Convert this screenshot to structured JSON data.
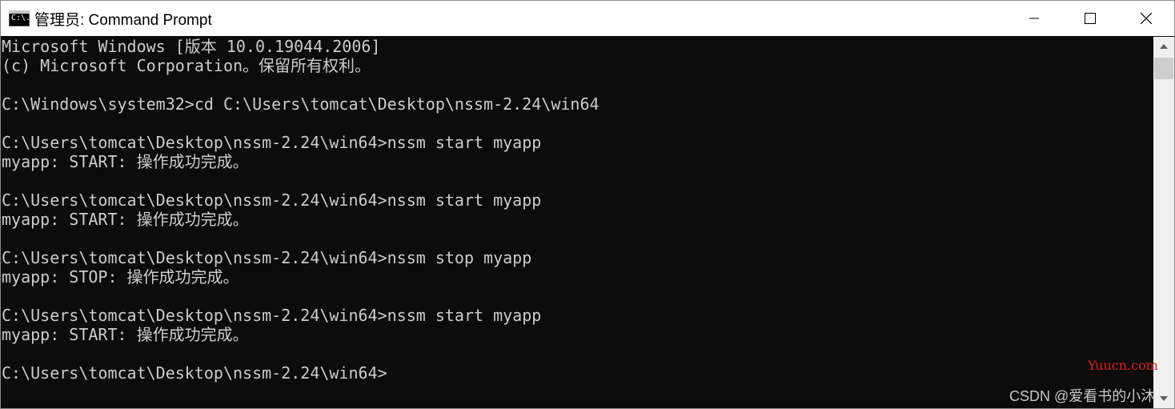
{
  "window": {
    "title": "管理员: Command Prompt",
    "icon": "console-icon",
    "icon_glyph": "C:\\."
  },
  "console": {
    "lines": [
      "Microsoft Windows [版本 10.0.19044.2006]",
      "(c) Microsoft Corporation。保留所有权利。",
      "",
      "C:\\Windows\\system32>cd C:\\Users\\tomcat\\Desktop\\nssm-2.24\\win64",
      "",
      "C:\\Users\\tomcat\\Desktop\\nssm-2.24\\win64>nssm start myapp",
      "myapp: START: 操作成功完成。",
      "",
      "C:\\Users\\tomcat\\Desktop\\nssm-2.24\\win64>nssm start myapp",
      "myapp: START: 操作成功完成。",
      "",
      "C:\\Users\\tomcat\\Desktop\\nssm-2.24\\win64>nssm stop myapp",
      "myapp: STOP: 操作成功完成。",
      "",
      "C:\\Users\\tomcat\\Desktop\\nssm-2.24\\win64>nssm start myapp",
      "myapp: START: 操作成功完成。",
      "",
      "C:\\Users\\tomcat\\Desktop\\nssm-2.24\\win64>"
    ]
  },
  "watermarks": {
    "site": "Yuucn.com",
    "author": "CSDN @爱看书的小沐"
  },
  "colors": {
    "console_bg": "#0c0c0c",
    "console_text": "#cccccc",
    "watermark_red": "#e02020"
  }
}
